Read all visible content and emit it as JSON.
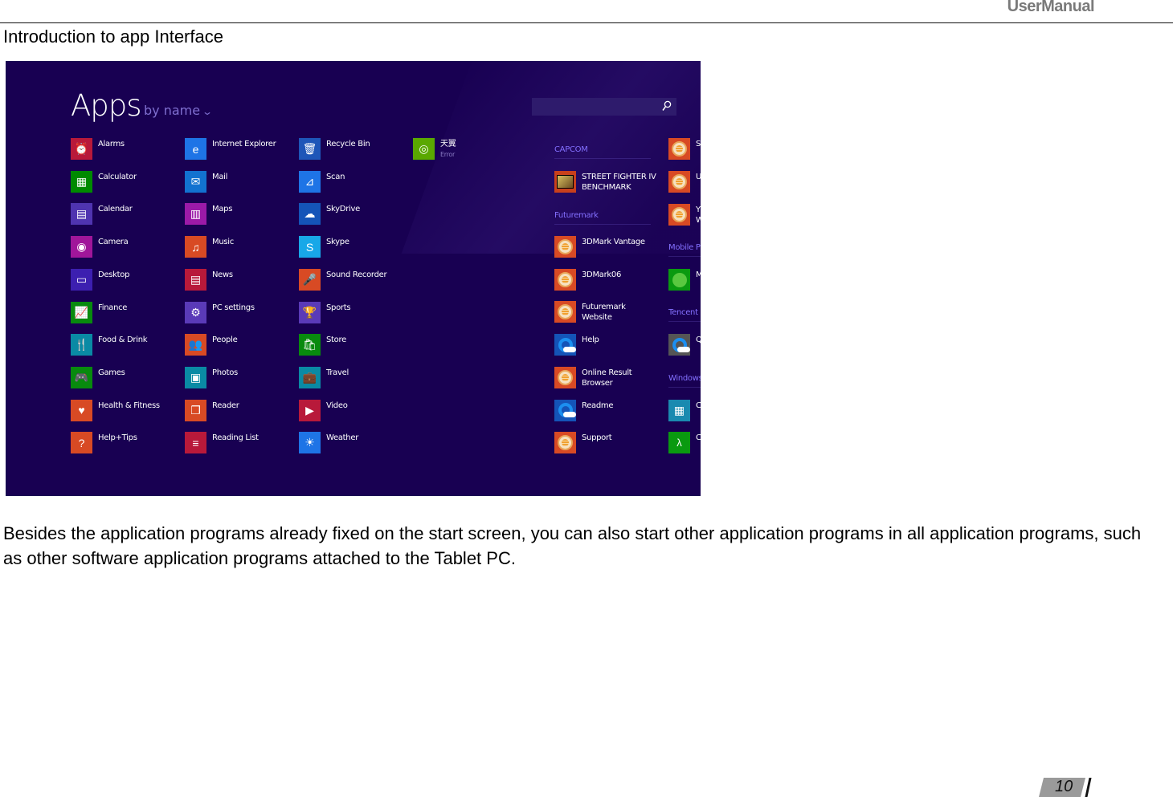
{
  "header": {
    "title": "UserManual"
  },
  "section_title": "Introduction to app Interface",
  "screenshot": {
    "heading": "Apps",
    "sort_label": "by name",
    "sort_icon": "chevron-down-icon",
    "search": {
      "placeholder": "",
      "icon": "search-icon"
    },
    "background_color": "#180052",
    "columns": [
      {
        "apps": [
          {
            "label": "Alarms",
            "icon": "alarm-clock-icon",
            "color": "#b8193a",
            "glyph": "⏰"
          },
          {
            "label": "Calculator",
            "icon": "calculator-icon",
            "color": "#008a00",
            "glyph": "▦"
          },
          {
            "label": "Calendar",
            "icon": "calendar-icon",
            "color": "#4f34b0",
            "glyph": "▤"
          },
          {
            "label": "Camera",
            "icon": "camera-icon",
            "color": "#a0169a",
            "glyph": "◉"
          },
          {
            "label": "Desktop",
            "icon": "desktop-icon",
            "color": "#3c1fb0",
            "glyph": "▭"
          },
          {
            "label": "Finance",
            "icon": "finance-chart-icon",
            "color": "#088a0e",
            "glyph": "📈"
          },
          {
            "label": "Food & Drink",
            "icon": "food-drink-icon",
            "color": "#0a8aa4",
            "glyph": "🍴"
          },
          {
            "label": "Games",
            "icon": "gamepad-icon",
            "color": "#088a0e",
            "glyph": "🎮"
          },
          {
            "label": "Health & Fitness",
            "icon": "heart-pulse-icon",
            "color": "#d84a24",
            "glyph": "♥"
          },
          {
            "label": "Help+Tips",
            "icon": "help-question-icon",
            "color": "#d84a24",
            "glyph": "?"
          }
        ]
      },
      {
        "apps": [
          {
            "label": "Internet Explorer",
            "icon": "internet-explorer-icon",
            "color": "#1e74e6",
            "glyph": "e"
          },
          {
            "label": "Mail",
            "icon": "mail-envelope-icon",
            "color": "#1272d0",
            "glyph": "✉"
          },
          {
            "label": "Maps",
            "icon": "map-icon",
            "color": "#9b1aa8",
            "glyph": "▥"
          },
          {
            "label": "Music",
            "icon": "headphones-icon",
            "color": "#d84a24",
            "glyph": "♫"
          },
          {
            "label": "News",
            "icon": "newspaper-icon",
            "color": "#b8193a",
            "glyph": "▤"
          },
          {
            "label": "PC settings",
            "icon": "gear-icon",
            "color": "#5a3ab8",
            "glyph": "⚙"
          },
          {
            "label": "People",
            "icon": "people-icon",
            "color": "#d84a24",
            "glyph": "👥"
          },
          {
            "label": "Photos",
            "icon": "photo-icon",
            "color": "#0a8aa4",
            "glyph": "▣"
          },
          {
            "label": "Reader",
            "icon": "reader-icon",
            "color": "#d84a24",
            "glyph": "❐"
          },
          {
            "label": "Reading List",
            "icon": "reading-list-icon",
            "color": "#b8193a",
            "glyph": "≡"
          }
        ]
      },
      {
        "apps": [
          {
            "label": "Recycle Bin",
            "icon": "recycle-bin-icon",
            "color": "#1e56b8",
            "glyph": "🗑"
          },
          {
            "label": "Scan",
            "icon": "scanner-icon",
            "color": "#1e74e6",
            "glyph": "⊿"
          },
          {
            "label": "SkyDrive",
            "icon": "cloud-icon",
            "color": "#1454b8",
            "glyph": "☁"
          },
          {
            "label": "Skype",
            "icon": "skype-icon",
            "color": "#18a8e8",
            "glyph": "S"
          },
          {
            "label": "Sound Recorder",
            "icon": "microphone-icon",
            "color": "#d84a24",
            "glyph": "🎤"
          },
          {
            "label": "Sports",
            "icon": "trophy-icon",
            "color": "#5a3ab8",
            "glyph": "🏆"
          },
          {
            "label": "Store",
            "icon": "store-bag-icon",
            "color": "#088a0e",
            "glyph": "🛍"
          },
          {
            "label": "Travel",
            "icon": "suitcase-icon",
            "color": "#0a8aa4",
            "glyph": "💼"
          },
          {
            "label": "Video",
            "icon": "video-icon",
            "color": "#b8193a",
            "glyph": "▶"
          },
          {
            "label": "Weather",
            "icon": "sun-icon",
            "color": "#1e74e6",
            "glyph": "☀"
          }
        ]
      },
      {
        "apps": [
          {
            "label": "天翼",
            "sub": "Error",
            "icon": "tianyi-swirl-icon",
            "color": "#5aa800",
            "glyph": "◎"
          }
        ]
      }
    ],
    "groups": [
      {
        "name": "CAPCOM",
        "apps": [
          {
            "label": "STREET FIGHTER IV\nBENCHMARK",
            "icon": "street-fighter-icon",
            "color": "#c8401c"
          }
        ]
      },
      {
        "name": "Futuremark",
        "apps": [
          {
            "label": "3DMark Vantage",
            "icon": "futuremark-icon",
            "color": "#d84a24"
          },
          {
            "label": "3DMark06",
            "icon": "futuremark-icon",
            "color": "#d84a24"
          },
          {
            "label": "Futuremark\nWebsite",
            "icon": "futuremark-icon",
            "color": "#d84a24"
          },
          {
            "label": "Help",
            "icon": "qq-browser-icon",
            "color": "#1454b8"
          },
          {
            "label": "Online Result\nBrowser",
            "icon": "futuremark-icon",
            "color": "#d84a24"
          },
          {
            "label": "Readme",
            "icon": "qq-browser-icon",
            "color": "#1454b8"
          },
          {
            "label": "Support",
            "icon": "futuremark-icon",
            "color": "#d84a24"
          }
        ]
      }
    ],
    "right_column": {
      "items": [
        {
          "type": "app",
          "label": "S",
          "icon": "futuremark-icon",
          "color": "#d84a24"
        },
        {
          "type": "app",
          "label": "U",
          "icon": "futuremark-icon",
          "color": "#d84a24"
        },
        {
          "type": "app",
          "label": "Y\nW",
          "icon": "futuremark-icon",
          "color": "#d84a24"
        },
        {
          "type": "group",
          "label": "Mobile P"
        },
        {
          "type": "app",
          "label": "M",
          "icon": "mobile-partner-icon",
          "color": "#0a9a10"
        },
        {
          "type": "group",
          "label": "Tencent"
        },
        {
          "type": "app",
          "label": "Q",
          "icon": "qq-browser-icon",
          "color": "#555555"
        },
        {
          "type": "group",
          "label": "Windows"
        },
        {
          "type": "app",
          "label": "C",
          "icon": "calculator-icon",
          "color": "#1a8ab0"
        },
        {
          "type": "app",
          "label": "C",
          "icon": "character-map-icon",
          "color": "#0a9a10"
        }
      ]
    }
  },
  "body_text": "Besides the application programs already fixed on the start screen, you can also start other application programs in all application programs, such as other software application programs attached to the Tablet PC.",
  "page_number": "10"
}
